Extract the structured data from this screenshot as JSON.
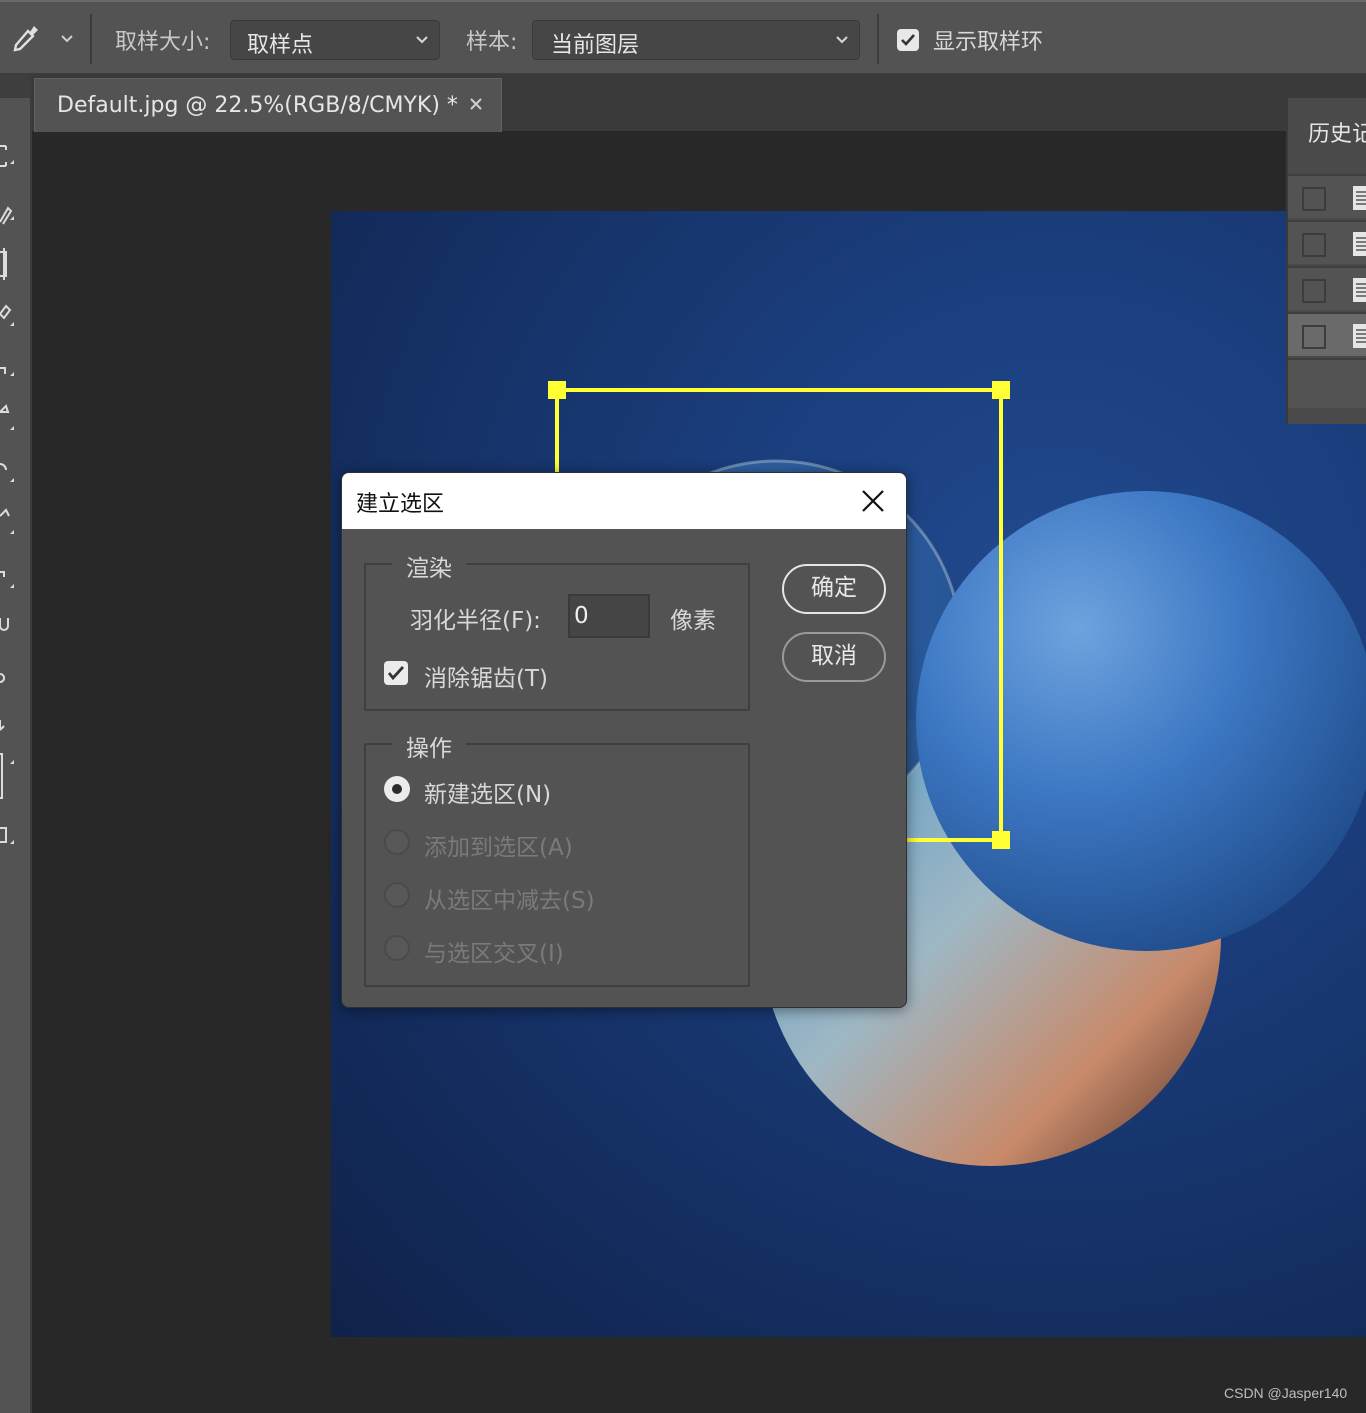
{
  "options_bar": {
    "tool_icon": "eyedropper-icon",
    "sample_size_label": "取样大小:",
    "sample_size_value": "取样点",
    "sample_label": "样本:",
    "sample_value": "当前图层",
    "show_ring_label": "显示取样环",
    "show_ring_checked": true
  },
  "document_tab": {
    "title": "Default.jpg @ 22.5%(RGB/8/CMYK) *",
    "close_icon": "close-icon"
  },
  "history_panel": {
    "title": "历史记",
    "rows": [
      {
        "selected": false
      },
      {
        "selected": false
      },
      {
        "selected": false
      },
      {
        "selected": true
      }
    ]
  },
  "dialog": {
    "title": "建立选区",
    "render_group": {
      "legend": "渲染",
      "feather_label": "羽化半径(F):",
      "feather_value": "0",
      "feather_unit": "像素",
      "antialias_label": "消除锯齿(T)",
      "antialias_checked": true
    },
    "operation_group": {
      "legend": "操作",
      "options": [
        {
          "label": "新建选区(N)",
          "selected": true,
          "enabled": true
        },
        {
          "label": "添加到选区(A)",
          "selected": false,
          "enabled": false
        },
        {
          "label": "从选区中减去(S)",
          "selected": false,
          "enabled": false
        },
        {
          "label": "与选区交叉(I)",
          "selected": false,
          "enabled": false
        }
      ]
    },
    "ok_label": "确定",
    "cancel_label": "取消"
  },
  "selection_color": "#ffff33",
  "watermark": "CSDN @Jasper140"
}
